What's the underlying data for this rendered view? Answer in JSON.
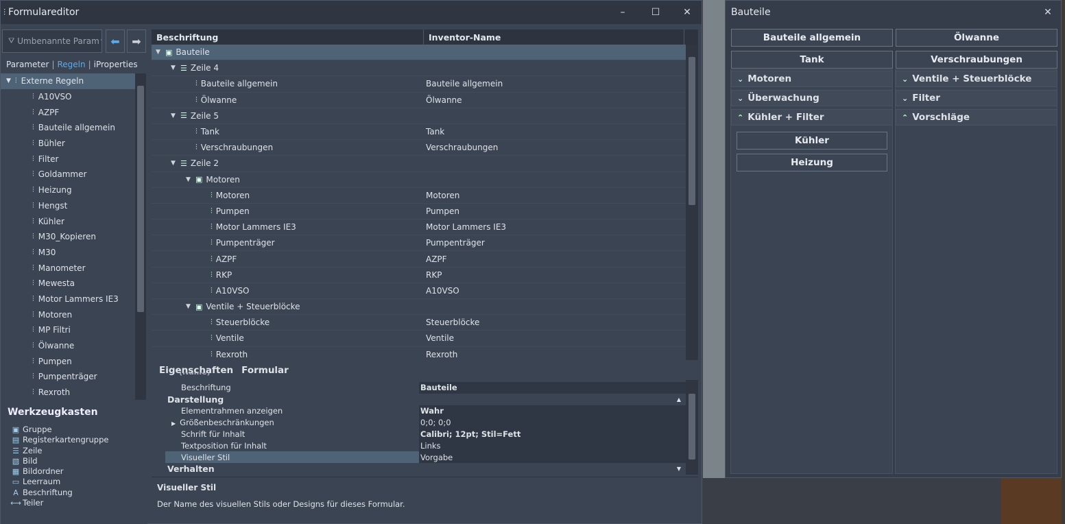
{
  "editor": {
    "title": "Formulareditor",
    "controls": {
      "minimize": "–",
      "maximize": "☐",
      "close": "✕"
    },
    "filter_placeholder": "Umbenannte Param",
    "tabs": [
      "Parameter",
      "Regeln",
      "iProperties"
    ],
    "tab_sep": "|",
    "rules_root": "Externe Regeln",
    "rules": [
      "A10VSO",
      "AZPF",
      "Bauteile allgemein",
      "Bühler",
      "Filter",
      "Goldammer",
      "Heizung",
      "Hengst",
      "Kühler",
      "M30_Kopieren",
      "M30",
      "Manometer",
      "Mewesta",
      "Motor Lammers IE3",
      "Motoren",
      "MP Filtri",
      "Ölwanne",
      "Pumpen",
      "Pumpenträger",
      "Rexroth"
    ],
    "toolbox_title": "Werkzeugkasten",
    "toolbox": [
      {
        "label": "Gruppe",
        "icon": "group-icon"
      },
      {
        "label": "Registerkartengruppe",
        "icon": "tab-group-icon"
      },
      {
        "label": "Zeile",
        "icon": "row-icon"
      },
      {
        "label": "Bild",
        "icon": "image-icon"
      },
      {
        "label": "Bildordner",
        "icon": "image-folder-icon"
      },
      {
        "label": "Leerraum",
        "icon": "space-icon"
      },
      {
        "label": "Beschriftung",
        "icon": "label-icon"
      },
      {
        "label": "Teiler",
        "icon": "splitter-icon"
      }
    ],
    "grid": {
      "headers": [
        "Beschriftung",
        "Inventor-Name"
      ],
      "rows": [
        {
          "name": "Bauteile",
          "value": "",
          "level": 0,
          "type": "root",
          "expand": "▼"
        },
        {
          "name": "Zeile 4",
          "value": "",
          "level": 1,
          "type": "row",
          "expand": "▼"
        },
        {
          "name": "Bauteile allgemein",
          "value": "Bauteile allgemein",
          "level": 2,
          "type": "rule",
          "expand": ""
        },
        {
          "name": "Ölwanne",
          "value": "Ölwanne",
          "level": 2,
          "type": "rule",
          "expand": ""
        },
        {
          "name": "Zeile 5",
          "value": "",
          "level": 1,
          "type": "row",
          "expand": "▼"
        },
        {
          "name": "Tank",
          "value": "Tank",
          "level": 2,
          "type": "rule",
          "expand": ""
        },
        {
          "name": "Verschraubungen",
          "value": "Verschraubungen",
          "level": 2,
          "type": "rule",
          "expand": ""
        },
        {
          "name": "Zeile 2",
          "value": "",
          "level": 1,
          "type": "row",
          "expand": "▼"
        },
        {
          "name": "Motoren",
          "value": "",
          "level": 2,
          "type": "group",
          "expand": "▼"
        },
        {
          "name": "Motoren",
          "value": "Motoren",
          "level": 3,
          "type": "rule",
          "expand": ""
        },
        {
          "name": "Pumpen",
          "value": "Pumpen",
          "level": 3,
          "type": "rule",
          "expand": ""
        },
        {
          "name": "Motor Lammers IE3",
          "value": "Motor Lammers IE3",
          "level": 3,
          "type": "rule",
          "expand": ""
        },
        {
          "name": "Pumpenträger",
          "value": "Pumpenträger",
          "level": 3,
          "type": "rule",
          "expand": ""
        },
        {
          "name": "AZPF",
          "value": "AZPF",
          "level": 3,
          "type": "rule",
          "expand": ""
        },
        {
          "name": "RKP",
          "value": "RKP",
          "level": 3,
          "type": "rule",
          "expand": ""
        },
        {
          "name": "A10VSO",
          "value": "A10VSO",
          "level": 3,
          "type": "rule",
          "expand": ""
        },
        {
          "name": "Ventile + Steuerblöcke",
          "value": "",
          "level": 2,
          "type": "group",
          "expand": "▼"
        },
        {
          "name": "Steuerblöcke",
          "value": "Steuerblöcke",
          "level": 3,
          "type": "rule",
          "expand": ""
        },
        {
          "name": "Ventile",
          "value": "Ventile",
          "level": 3,
          "type": "rule",
          "expand": ""
        },
        {
          "name": "Rexroth",
          "value": "Rexroth",
          "level": 3,
          "type": "rule",
          "expand": ""
        }
      ]
    },
    "props": {
      "tabs": [
        "Eigenschaften",
        "Formular"
      ],
      "cut_label": "(Name)",
      "beschriftung_key": "Beschriftung",
      "beschriftung_val": "Bauteile",
      "cat_darstellung": "Darstellung",
      "rows": [
        {
          "key": "Elementrahmen anzeigen",
          "val": "Wahr",
          "bold": true,
          "expand": ""
        },
        {
          "key": "Größenbeschränkungen",
          "val": "0;0; 0;0",
          "bold": false,
          "expand": "▶"
        },
        {
          "key": "Schrift für Inhalt",
          "val": "Calibri; 12pt; Stil=Fett",
          "bold": true,
          "expand": ""
        },
        {
          "key": "Textposition für Inhalt",
          "val": "Links",
          "bold": false,
          "expand": ""
        },
        {
          "key": "Visueller Stil",
          "val": "Vorgabe",
          "bold": false,
          "expand": ""
        }
      ],
      "cat_verhalten": "Verhalten",
      "desc_title": "Visueller Stil",
      "desc_text": "Der Name des visuellen Stils oder Designs für dieses Formular."
    }
  },
  "bauteile": {
    "title": "Bauteile",
    "close": "✕",
    "buttons": [
      "Bauteile allgemein",
      "Ölwanne",
      "Tank",
      "Verschraubungen"
    ],
    "groups_left": [
      {
        "label": "Motoren",
        "chevron": "⌄"
      },
      {
        "label": "Überwachung",
        "chevron": "⌄"
      },
      {
        "label": "Kühler + Filter",
        "chevron": "⌃"
      }
    ],
    "groups_right": [
      {
        "label": "Ventile + Steuerblöcke",
        "chevron": "⌄"
      },
      {
        "label": "Filter",
        "chevron": "⌄"
      },
      {
        "label": "Vorschläge",
        "chevron": "⌃"
      }
    ],
    "inner_buttons": [
      "Kühler",
      "Heizung"
    ]
  }
}
